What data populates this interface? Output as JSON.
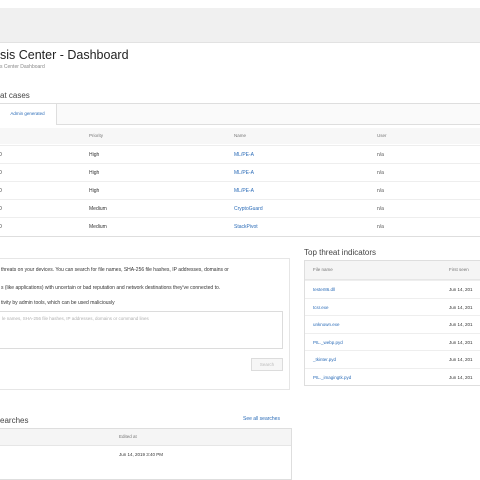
{
  "page": {
    "title": "sis Center - Dashboard",
    "subtitle": "s Center Dashboard"
  },
  "threat_cases": {
    "section_title": "at cases",
    "tab_label": "Admin generated",
    "columns": [
      "Priority",
      "Name",
      "User"
    ],
    "rows": [
      {
        "id": "0",
        "priority": "High",
        "name": "ML/PE-A",
        "user": "n/a"
      },
      {
        "id": "0",
        "priority": "High",
        "name": "ML/PE-A",
        "user": "n/a"
      },
      {
        "id": "0",
        "priority": "High",
        "name": "ML/PE-A",
        "user": "n/a"
      },
      {
        "id": "0",
        "priority": "Medium",
        "name": "CryptoGuard",
        "user": "n/a"
      },
      {
        "id": "0",
        "priority": "Medium",
        "name": "StackPivot",
        "user": "n/a"
      }
    ]
  },
  "threat_search": {
    "line1": "threats on your devices. You can search for file names, SHA-256 file hashes, IP addresses, domains or",
    "line2": "s (like applications) with uncertain or bad reputation and network destinations they've connected to.",
    "line3": "tivity by admin tools, which can be used maliciously",
    "placeholder": "le names, SHA-256 file hashes, IP addresses, domains or command lines",
    "search_button": "Search"
  },
  "top_indicators": {
    "title": "Top threat indicators",
    "columns": [
      "File name",
      "First seen"
    ],
    "rows": [
      {
        "file": "tester86.dll",
        "first_seen": "Jun 14, 201"
      },
      {
        "file": "tcsr.exe",
        "first_seen": "Jun 14, 201"
      },
      {
        "file": "unknown.exe",
        "first_seen": "Jun 14, 201"
      },
      {
        "file": "PIL._webp.pyd",
        "first_seen": "Jun 14, 201"
      },
      {
        "file": "_tkinter.pyd",
        "first_seen": "Jun 14, 201"
      },
      {
        "file": "PIL._imagingtk.pyd",
        "first_seen": "Jun 14, 201"
      }
    ]
  },
  "recent_searches": {
    "title": "earches",
    "see_all": "See all searches",
    "column": "Edited at",
    "rows": [
      {
        "edited_at": "Jun 14, 2019 3:40 PM"
      }
    ]
  }
}
